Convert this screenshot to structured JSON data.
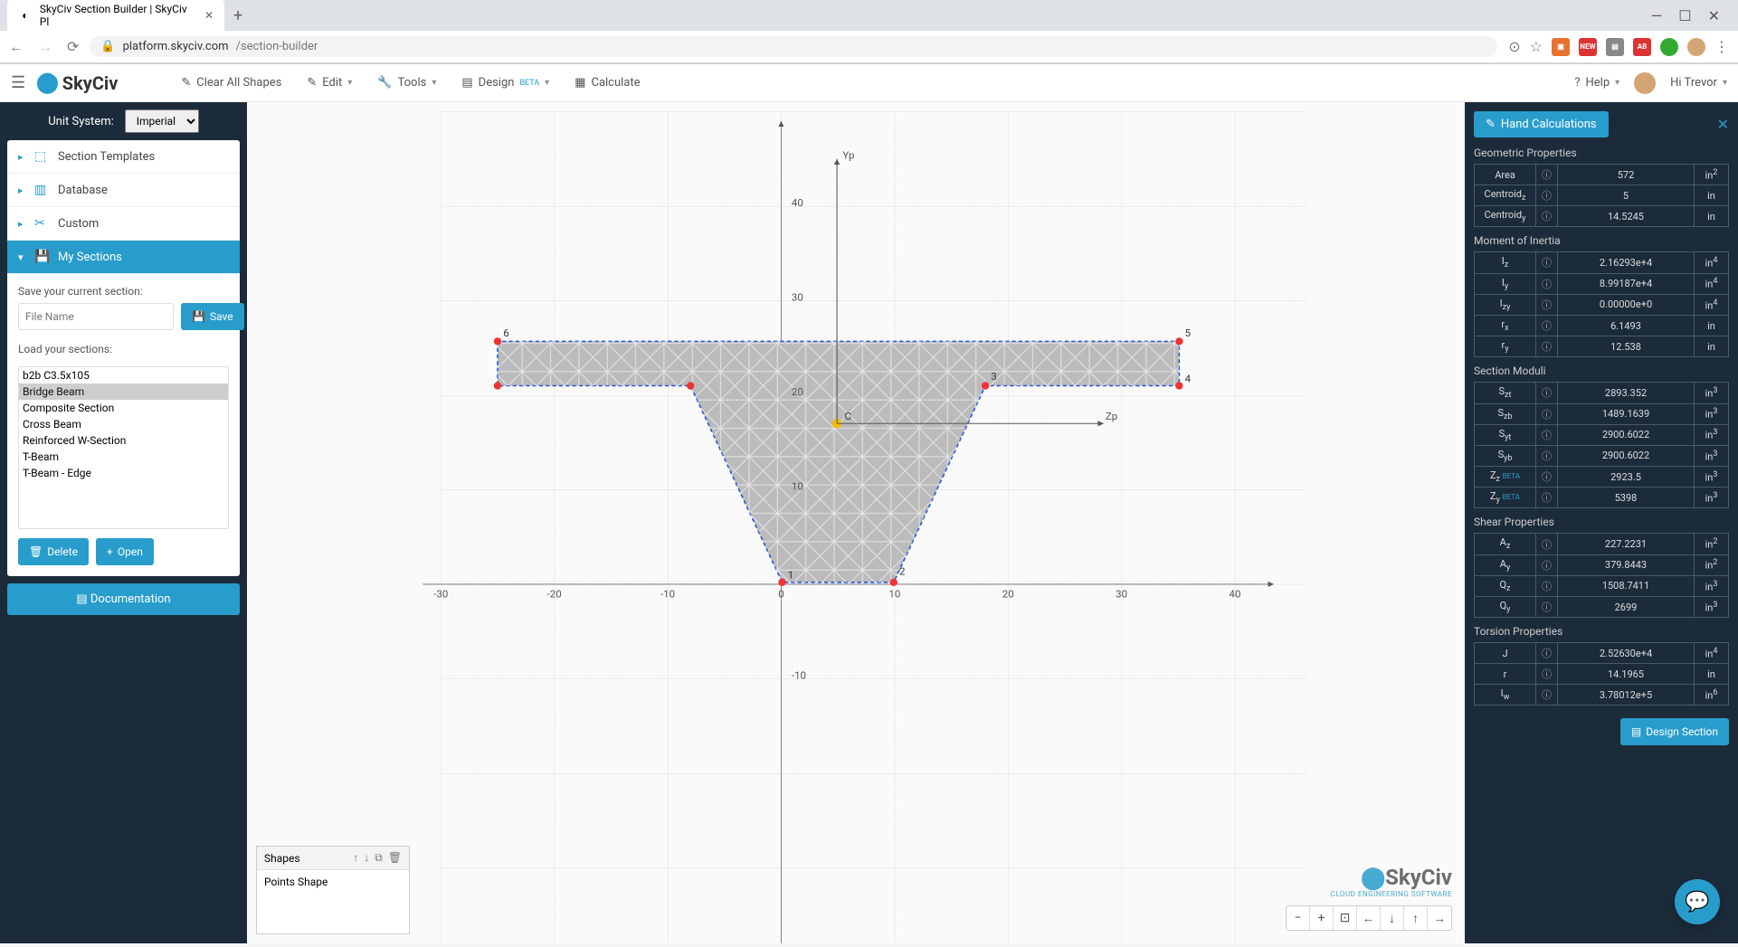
{
  "browser": {
    "tab_title": "SkyCiv Section Builder | SkyCiv Pl",
    "url_domain": "platform.skyciv.com",
    "url_path": "/section-builder"
  },
  "topbar": {
    "logo": "SkyCiv",
    "menu": {
      "clear": "Clear All Shapes",
      "edit": "Edit",
      "tools": "Tools",
      "design": "Design",
      "design_beta": "BETA",
      "calculate": "Calculate"
    },
    "help": "Help",
    "greeting": "Hi Trevor"
  },
  "sidebar": {
    "unit_label": "Unit System:",
    "unit_value": "Imperial",
    "accordion": {
      "templates": "Section Templates",
      "database": "Database",
      "custom": "Custom",
      "my_sections": "My Sections"
    },
    "save_label": "Save your current section:",
    "filename_placeholder": "File Name",
    "save_btn": "Save",
    "load_label": "Load your sections:",
    "sections": [
      "b2b C3.5x105",
      "Bridge Beam",
      "Composite Section",
      "Cross Beam",
      "Reinforced W-Section",
      "T-Beam",
      "T-Beam - Edge"
    ],
    "selected_section": "Bridge Beam",
    "delete_btn": "Delete",
    "open_btn": "Open",
    "doc_btn": "Documentation"
  },
  "canvas": {
    "shapes_title": "Shapes",
    "shape_item": "Points Shape",
    "x_ticks": [
      "-30",
      "-20",
      "-10",
      "0",
      "10",
      "20",
      "30",
      "40"
    ],
    "y_ticks": [
      "-10",
      "10",
      "20",
      "30",
      "40"
    ],
    "yp_label": "Yp",
    "zp_label": "Zp",
    "centroid_label": "C",
    "watermark_logo": "SkyCiv",
    "watermark_sub": "CLOUD ENGINEERING SOFTWARE"
  },
  "results": {
    "header_btn": "Hand Calculations",
    "groups": {
      "geometric": "Geometric Properties",
      "moment": "Moment of Inertia",
      "moduli": "Section Moduli",
      "shear": "Shear Properties",
      "torsion": "Torsion Properties"
    },
    "geometric": [
      {
        "label": "Area",
        "value": "572",
        "unit": "in",
        "sup": "2"
      },
      {
        "label": "Centroid",
        "sub": "z",
        "value": "5",
        "unit": "in"
      },
      {
        "label": "Centroid",
        "sub": "y",
        "value": "14.5245",
        "unit": "in"
      }
    ],
    "moment": [
      {
        "label": "I",
        "sub": "z",
        "value": "2.16293e+4",
        "unit": "in",
        "sup": "4"
      },
      {
        "label": "I",
        "sub": "y",
        "value": "8.99187e+4",
        "unit": "in",
        "sup": "4"
      },
      {
        "label": "I",
        "sub": "zy",
        "value": "0.00000e+0",
        "unit": "in",
        "sup": "4"
      },
      {
        "label": "r",
        "sub": "x",
        "value": "6.1493",
        "unit": "in"
      },
      {
        "label": "r",
        "sub": "y",
        "value": "12.538",
        "unit": "in"
      }
    ],
    "moduli": [
      {
        "label": "S",
        "sub": "zt",
        "value": "2893.352",
        "unit": "in",
        "sup": "3"
      },
      {
        "label": "S",
        "sub": "zb",
        "value": "1489.1639",
        "unit": "in",
        "sup": "3"
      },
      {
        "label": "S",
        "sub": "yt",
        "value": "2900.6022",
        "unit": "in",
        "sup": "3"
      },
      {
        "label": "S",
        "sub": "yb",
        "value": "2900.6022",
        "unit": "in",
        "sup": "3"
      },
      {
        "label": "Z",
        "sub": "z",
        "beta": "BETA",
        "value": "2923.5",
        "unit": "in",
        "sup": "3"
      },
      {
        "label": "Z",
        "sub": "y",
        "beta": "BETA",
        "value": "5398",
        "unit": "in",
        "sup": "3"
      }
    ],
    "shear": [
      {
        "label": "A",
        "sub": "z",
        "value": "227.2231",
        "unit": "in",
        "sup": "2"
      },
      {
        "label": "A",
        "sub": "y",
        "value": "379.8443",
        "unit": "in",
        "sup": "2"
      },
      {
        "label": "Q",
        "sub": "z",
        "value": "1508.7411",
        "unit": "in",
        "sup": "3"
      },
      {
        "label": "Q",
        "sub": "y",
        "value": "2699",
        "unit": "in",
        "sup": "3"
      }
    ],
    "torsion": [
      {
        "label": "J",
        "value": "2.52630e+4",
        "unit": "in",
        "sup": "4"
      },
      {
        "label": "r",
        "value": "14.1965",
        "unit": "in"
      },
      {
        "label": "I",
        "sub": "w",
        "value": "3.78012e+5",
        "unit": "in",
        "sup": "6"
      }
    ],
    "design_btn": "Design Section"
  }
}
